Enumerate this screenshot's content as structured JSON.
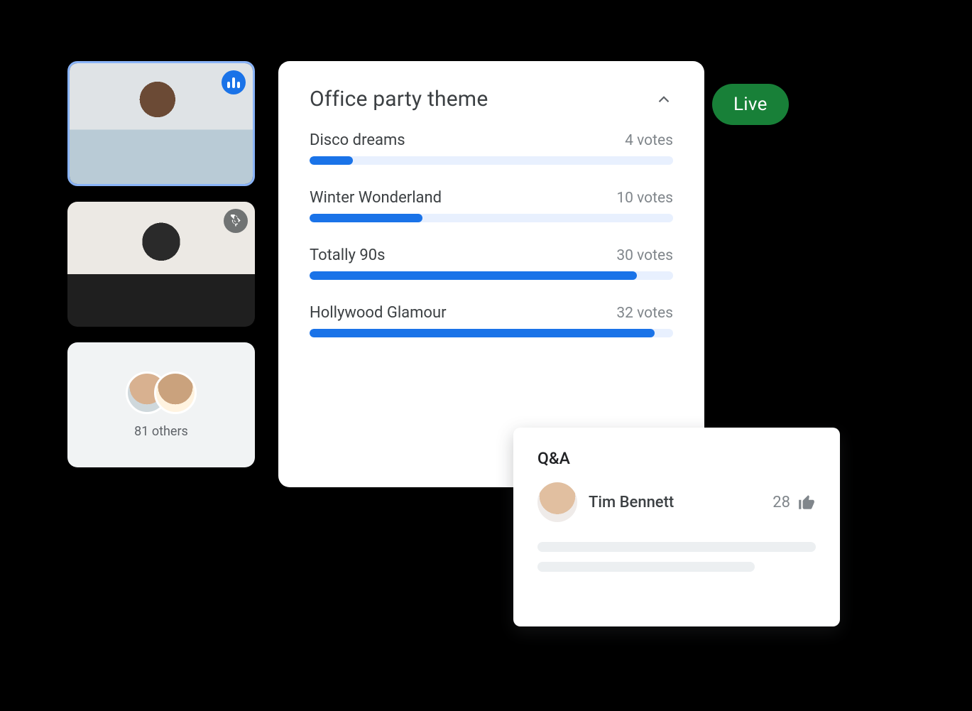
{
  "participants": {
    "tile1_speaking": true,
    "tile2_muted": true,
    "others_label": "81 others"
  },
  "live_label": "Live",
  "poll": {
    "title": "Office party theme",
    "votes_suffix": "votes",
    "options": [
      {
        "name": "Disco dreams",
        "votes": 4,
        "votes_text": "4 votes",
        "pct": 12
      },
      {
        "name": "Winter Wonderland",
        "votes": 10,
        "votes_text": "10 votes",
        "pct": 31
      },
      {
        "name": "Totally 90s",
        "votes": 30,
        "votes_text": "30 votes",
        "pct": 90
      },
      {
        "name": "Hollywood Glamour",
        "votes": 32,
        "votes_text": "32 votes",
        "pct": 95
      }
    ]
  },
  "qa": {
    "title": "Q&A",
    "author": "Tim Bennett",
    "likes": "28"
  },
  "colors": {
    "accent": "#1a73e8",
    "live": "#188038",
    "track": "#e8f0fe"
  }
}
